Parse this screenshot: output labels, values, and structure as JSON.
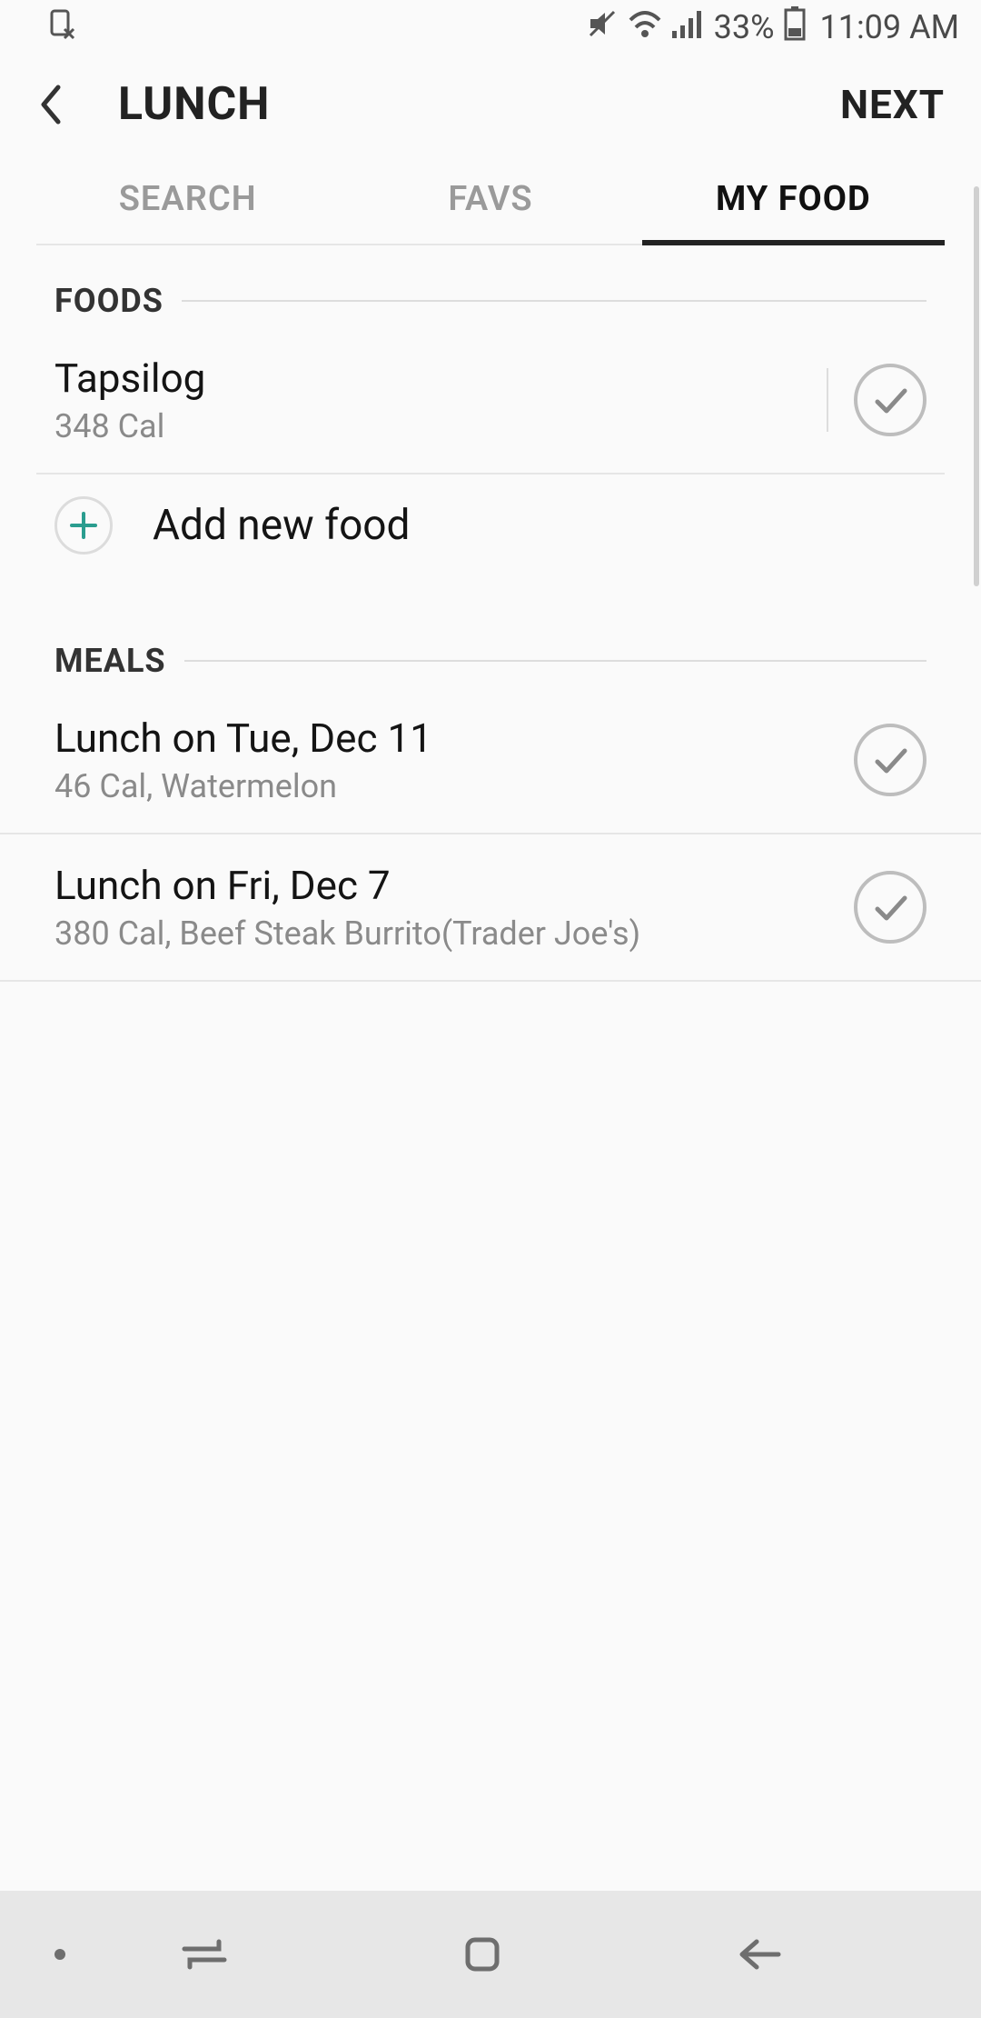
{
  "status": {
    "battery_pct": "33%",
    "time": "11:09 AM"
  },
  "header": {
    "title": "LUNCH",
    "next": "NEXT"
  },
  "tabs": [
    {
      "label": "SEARCH",
      "active": false
    },
    {
      "label": "FAVS",
      "active": false
    },
    {
      "label": "MY FOOD",
      "active": true
    }
  ],
  "sections": {
    "foods": {
      "label": "FOODS",
      "items": [
        {
          "title": "Tapsilog",
          "sub": "348 Cal"
        }
      ],
      "add_label": "Add new food"
    },
    "meals": {
      "label": "MEALS",
      "items": [
        {
          "title": "Lunch on Tue, Dec 11",
          "sub": "46 Cal, Watermelon"
        },
        {
          "title": "Lunch on Fri, Dec 7",
          "sub": "380 Cal, Beef Steak Burrito(Trader Joe's)"
        }
      ]
    }
  }
}
